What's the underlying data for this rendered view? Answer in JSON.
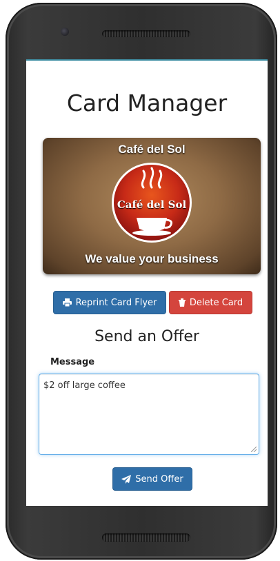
{
  "header": {
    "title": "Card Manager"
  },
  "card": {
    "name": "Café del Sol",
    "logo_text": "Café del Sol",
    "slogan": "We value your business"
  },
  "actions": {
    "reprint_label": "Reprint Card Flyer",
    "delete_label": "Delete Card"
  },
  "offer": {
    "section_title": "Send an Offer",
    "message_label": "Message",
    "message_value": "$2 off large coffee",
    "send_label": "Send Offer"
  },
  "colors": {
    "primary": "#2f6ea8",
    "danger": "#d4453d",
    "focus_border": "#66afe9",
    "accent_line": "#3f8fa4"
  },
  "icons": {
    "reprint": "print-icon",
    "delete": "trash-icon",
    "send": "paper-plane-icon"
  }
}
